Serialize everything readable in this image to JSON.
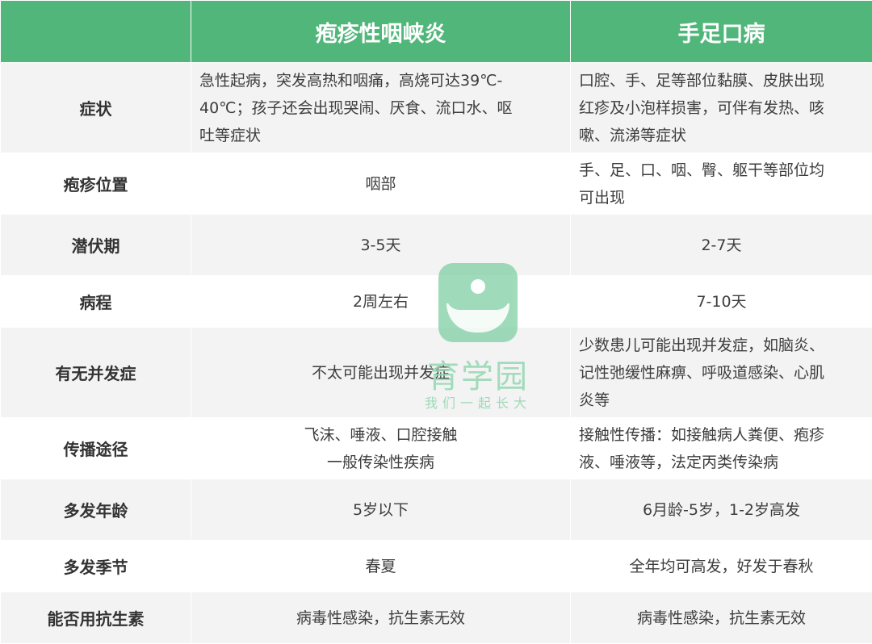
{
  "header": {
    "col1": "疱疹性咽峡炎",
    "col2": "手足口病"
  },
  "rows": [
    {
      "label": "症状",
      "col1_lines": [
        "急性起病，突发高热和咽痛，高烧可达39℃-",
        "40℃；孩子还会出现哭闹、厌食、流口水、呕",
        "吐等症状"
      ],
      "col2_lines": [
        "口腔、手、足等部位黏膜、皮肤出现",
        "红疹及小泡样损害，可伴有发热、咳",
        "嗽、流涕等症状"
      ]
    },
    {
      "label": "疱疹位置",
      "col1_lines": [
        "咽部"
      ],
      "col2_lines": [
        "手、足、口、咽、臀、躯干等部位均",
        "可出现"
      ]
    },
    {
      "label": "潜伏期",
      "col1_lines": [
        "3-5天"
      ],
      "col2_lines": [
        "2-7天"
      ]
    },
    {
      "label": "病程",
      "col1_lines": [
        "2周左右"
      ],
      "col2_lines": [
        "7-10天"
      ]
    },
    {
      "label": "有无并发症",
      "col1_lines": [
        "不太可能出现并发症"
      ],
      "col2_lines": [
        "少数患儿可能出现并发症，如脑炎、",
        "记性弛缓性麻痹、呼吸道感染、心肌",
        "炎等"
      ]
    },
    {
      "label": "传播途径",
      "col1_lines": [
        "飞沫、唾液、口腔接触",
        "一般传染性疾病"
      ],
      "col2_lines": [
        "接触性传播：如接触病人粪便、疱疹",
        "液、唾液等，法定丙类传染病"
      ]
    },
    {
      "label": "多发年龄",
      "col1_lines": [
        "5岁以下"
      ],
      "col2_lines": [
        "6月龄-5岁，1-2岁高发"
      ]
    },
    {
      "label": "多发季节",
      "col1_lines": [
        "春夏"
      ],
      "col2_lines": [
        "全年均可高发，好发于春秋"
      ]
    },
    {
      "label": "能否用抗生素",
      "col1_lines": [
        "病毒性感染，抗生素无效"
      ],
      "col2_lines": [
        "病毒性感染，抗生素无效"
      ]
    }
  ],
  "watermark": {
    "title": "育学园",
    "subtitle": "我们一起长大"
  }
}
